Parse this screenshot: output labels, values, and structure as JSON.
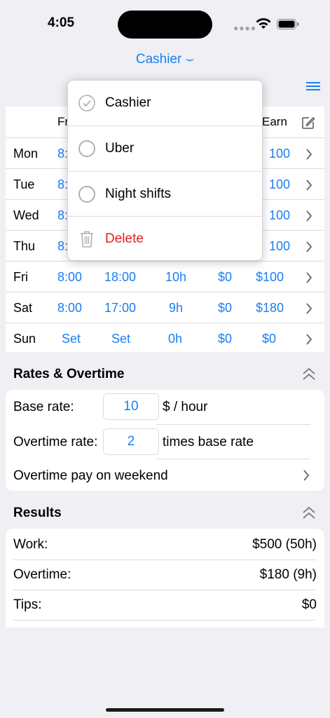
{
  "status": {
    "time": "4:05"
  },
  "header": {
    "title": "Cashier ⌣"
  },
  "week": {
    "columns": [
      "Fr",
      "Earn"
    ],
    "rows": [
      {
        "day": "Mon",
        "from": "8:",
        "to": "",
        "hours": "",
        "tips": "",
        "earn": "100"
      },
      {
        "day": "Tue",
        "from": "8:",
        "to": "",
        "hours": "",
        "tips": "",
        "earn": "100"
      },
      {
        "day": "Wed",
        "from": "8:",
        "to": "",
        "hours": "",
        "tips": "",
        "earn": "100"
      },
      {
        "day": "Thu",
        "from": "8:",
        "to": "",
        "hours": "",
        "tips": "",
        "earn": "100"
      },
      {
        "day": "Fri",
        "from": "8:00",
        "to": "18:00",
        "hours": "10h",
        "tips": "$0",
        "earn": "$100"
      },
      {
        "day": "Sat",
        "from": "8:00",
        "to": "17:00",
        "hours": "9h",
        "tips": "$0",
        "earn": "$180"
      },
      {
        "day": "Sun",
        "from": "Set",
        "to": "Set",
        "hours": "0h",
        "tips": "$0",
        "earn": "$0"
      }
    ]
  },
  "rates": {
    "title": "Rates & Overtime",
    "base_label": "Base rate:",
    "base_value": "10",
    "base_unit": "$ / hour",
    "overtime_label": "Overtime rate:",
    "overtime_value": "2",
    "overtime_unit": "times base rate",
    "weekend_label": "Overtime pay on weekend"
  },
  "results": {
    "title": "Results",
    "work_label": "Work:",
    "work_value": "$500 (50h)",
    "overtime_label": "Overtime:",
    "overtime_value": "$180 (9h)",
    "tips_label": "Tips:",
    "tips_value": "$0"
  },
  "dropdown": {
    "items": [
      "Cashier",
      "Uber",
      "Night shifts"
    ],
    "delete_label": "Delete",
    "selected": "Cashier"
  },
  "colors": {
    "accent": "#1a7ff5",
    "destructive": "#e8201f",
    "background": "#efeff4"
  }
}
